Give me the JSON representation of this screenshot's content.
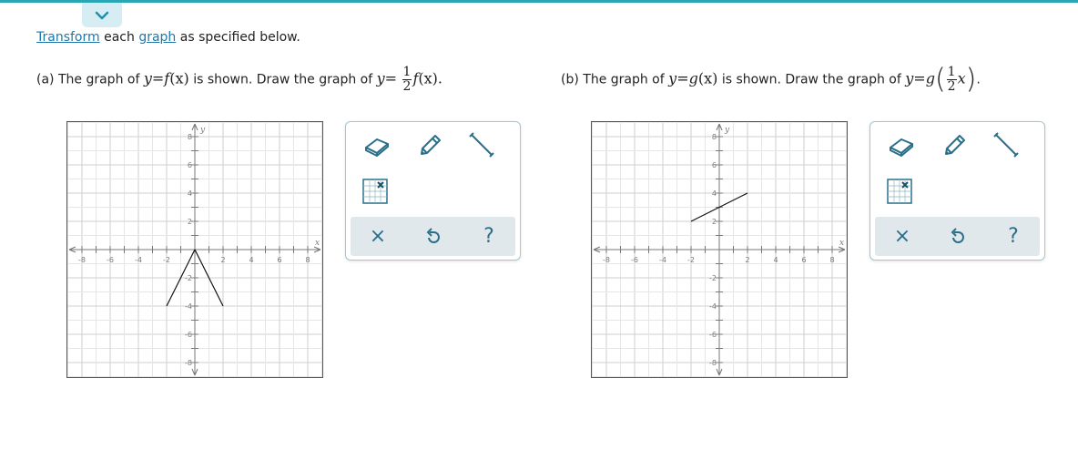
{
  "colors": {
    "accent": "#2aa7b5",
    "link": "#1f77a8",
    "toolbar_bg": "#e1e8ec",
    "icon": "#2a6f8a"
  },
  "header": {
    "collapse_icon": "chevron-down-icon",
    "link_transform": "Transform",
    "text_each": "each",
    "link_graph": "graph",
    "text_rest": "as specified below."
  },
  "part_a": {
    "label": "(a)",
    "sentence1": "The graph of",
    "eq1_lhs": "y",
    "eq1_eq": "=",
    "eq1_func": "f",
    "eq1_arg": "(x)",
    "sentence2": "is shown. Draw the graph of",
    "eq2_lhs": "y",
    "eq2_eq": "=",
    "frac_num": "1",
    "frac_den": "2",
    "eq2_func": "f",
    "eq2_arg": "(x).",
    "graph": {
      "x_axis_label": "x",
      "y_axis_label": "y",
      "x_ticks": [
        "-8",
        "-6",
        "-4",
        "-2",
        "2",
        "4",
        "6",
        "8"
      ],
      "y_ticks": [
        "8",
        "6",
        "4",
        "2",
        "-2",
        "-4",
        "-6",
        "-8"
      ],
      "range": [
        -9,
        9
      ],
      "drawn_segments": [
        [
          [
            -2,
            -4
          ],
          [
            0,
            0
          ]
        ],
        [
          [
            0,
            0
          ],
          [
            2,
            -4
          ]
        ]
      ]
    }
  },
  "part_b": {
    "label": "(b)",
    "sentence1": "The graph of",
    "eq1_lhs": "y",
    "eq1_eq": "=",
    "eq1_func": "g",
    "eq1_arg": "(x)",
    "sentence2": "is shown. Draw the graph of",
    "eq2_lhs": "y",
    "eq2_eq": "=",
    "eq2_func": "g",
    "frac_num": "1",
    "frac_den": "2",
    "frac_var": "x",
    "end_punct": ".",
    "graph": {
      "x_axis_label": "x",
      "y_axis_label": "y",
      "x_ticks": [
        "-8",
        "-6",
        "-4",
        "-2",
        "2",
        "4",
        "6",
        "8"
      ],
      "y_ticks": [
        "8",
        "6",
        "4",
        "2",
        "-2",
        "-4",
        "-6",
        "-8"
      ],
      "range": [
        -9,
        9
      ],
      "drawn_segments": [
        [
          [
            -2,
            2
          ],
          [
            2,
            4
          ]
        ]
      ]
    }
  },
  "toolbox": {
    "tools": [
      "eraser-icon",
      "pencil-icon",
      "line-segment-icon",
      "grid-point-icon"
    ],
    "actions": {
      "clear": "×",
      "undo": "undo-icon",
      "help": "?"
    }
  }
}
